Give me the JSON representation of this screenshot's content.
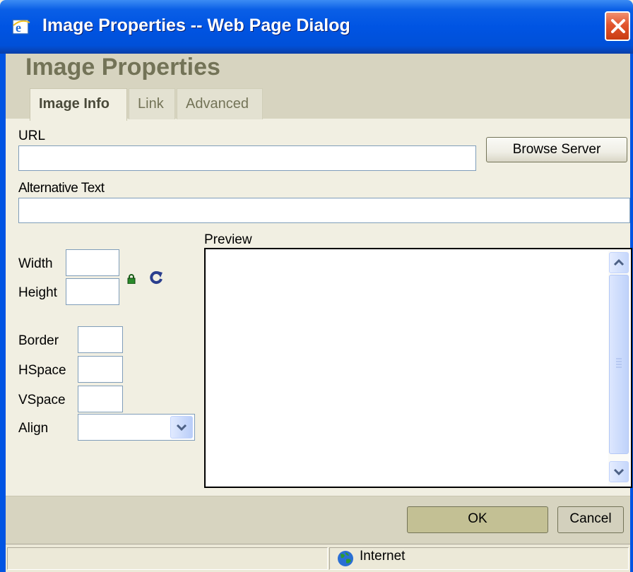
{
  "window": {
    "title": "Image Properties -- Web Page Dialog"
  },
  "dialog": {
    "title": "Image Properties",
    "tabs": [
      {
        "label": "Image Info",
        "active": true
      },
      {
        "label": "Link",
        "active": false
      },
      {
        "label": "Advanced",
        "active": false
      }
    ]
  },
  "form": {
    "url_label": "URL",
    "url_value": "",
    "browse_button": "Browse Server",
    "alt_label": "Alternative Text",
    "alt_value": "",
    "width_label": "Width",
    "width_value": "",
    "height_label": "Height",
    "height_value": "",
    "border_label": "Border",
    "border_value": "",
    "hspace_label": "HSpace",
    "hspace_value": "",
    "vspace_label": "VSpace",
    "vspace_value": "",
    "align_label": "Align",
    "align_value": "",
    "preview_label": "Preview"
  },
  "footer": {
    "ok_button": "OK",
    "cancel_button": "Cancel"
  },
  "statusbar": {
    "zone_text": "Internet"
  },
  "icons": {
    "window": "ie-icon",
    "close": "close-icon",
    "lock": "lock-icon",
    "reset": "refresh-icon",
    "zone": "globe-icon"
  },
  "colors": {
    "titlebar": "#0054e3",
    "dialog_bg": "#f1efe2",
    "band": "#d7d4c0",
    "title_text": "#737357",
    "close": "#e2552e"
  }
}
